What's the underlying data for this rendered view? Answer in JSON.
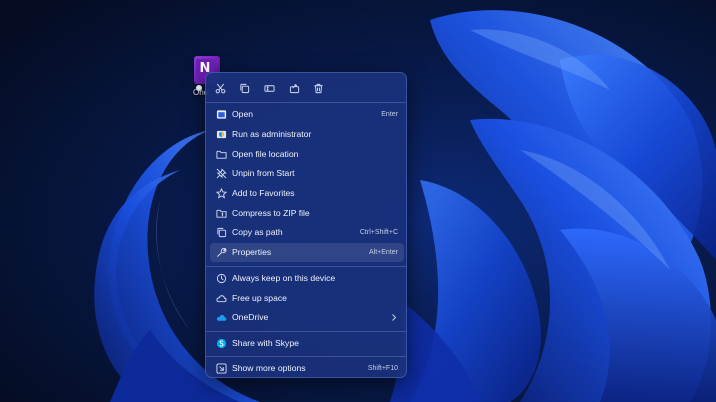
{
  "desktop_icon": {
    "letter": "N",
    "caption": "One"
  },
  "quick_actions": [
    {
      "icon": "cut-icon"
    },
    {
      "icon": "copy-icon"
    },
    {
      "icon": "rename-icon"
    },
    {
      "icon": "share-icon"
    },
    {
      "icon": "delete-icon"
    }
  ],
  "menu": {
    "open": {
      "label": "Open",
      "shortcut": "Enter"
    },
    "run_as_admin": {
      "label": "Run as administrator"
    },
    "open_file_location": {
      "label": "Open file location"
    },
    "unpin_from_start": {
      "label": "Unpin from Start"
    },
    "add_to_favorites": {
      "label": "Add to Favorites"
    },
    "compress_zip": {
      "label": "Compress to ZIP file"
    },
    "copy_as_path": {
      "label": "Copy as path",
      "shortcut": "Ctrl+Shift+C"
    },
    "properties": {
      "label": "Properties",
      "shortcut": "Alt+Enter"
    },
    "always_keep": {
      "label": "Always keep on this device"
    },
    "free_up_space": {
      "label": "Free up space"
    },
    "onedrive": {
      "label": "OneDrive"
    },
    "share_skype": {
      "label": "Share with Skype"
    },
    "show_more": {
      "label": "Show more options",
      "shortcut": "Shift+F10"
    }
  },
  "colors": {
    "menu_bg": "#1a317c",
    "accent_blue": "#2b7de9",
    "skype_blue": "#00aff0",
    "onedrive_blue": "#1d9bf0"
  }
}
